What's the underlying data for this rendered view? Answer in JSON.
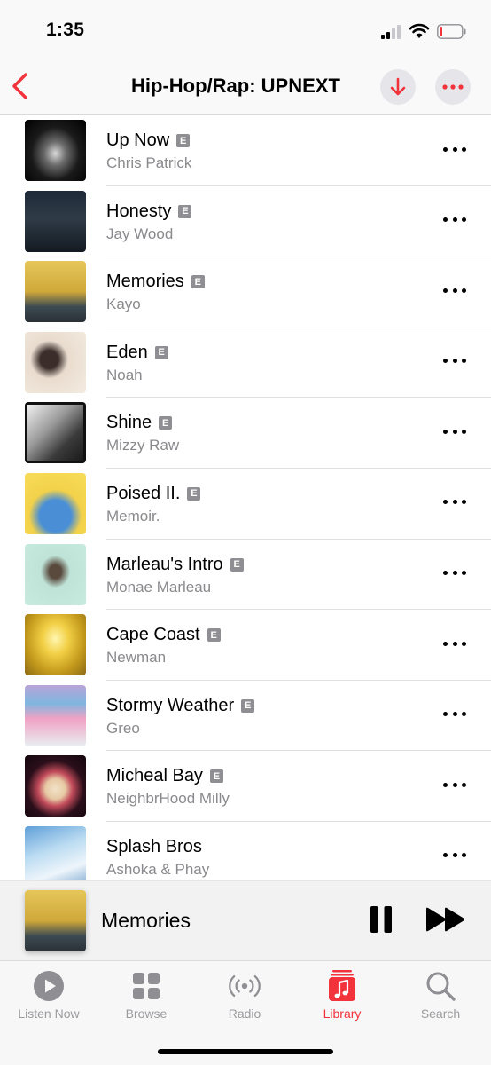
{
  "status": {
    "time": "1:35"
  },
  "nav": {
    "title": "Hip-Hop/Rap: UPNEXT"
  },
  "songs": [
    {
      "title": "Up Now",
      "artist": "Chris Patrick",
      "explicit": "E"
    },
    {
      "title": "Honesty",
      "artist": "Jay Wood",
      "explicit": "E"
    },
    {
      "title": "Memories",
      "artist": "Kayo",
      "explicit": "E"
    },
    {
      "title": "Eden",
      "artist": "Noah",
      "explicit": "E"
    },
    {
      "title": "Shine",
      "artist": "Mizzy Raw",
      "explicit": "E"
    },
    {
      "title": "Poised II.",
      "artist": "Memoir.",
      "explicit": "E"
    },
    {
      "title": "Marleau's Intro",
      "artist": "Monae Marleau",
      "explicit": "E"
    },
    {
      "title": "Cape Coast",
      "artist": "Newman",
      "explicit": "E"
    },
    {
      "title": "Stormy Weather",
      "artist": "Greo",
      "explicit": "E"
    },
    {
      "title": "Micheal Bay",
      "artist": "NeighbrHood Milly",
      "explicit": "E"
    },
    {
      "title": "Splash Bros",
      "artist": "Ashoka & Phay",
      "explicit": ""
    }
  ],
  "mini_player": {
    "title": "Memories"
  },
  "tabs": [
    {
      "label": "Listen Now",
      "icon": "play-circle-icon"
    },
    {
      "label": "Browse",
      "icon": "grid-icon"
    },
    {
      "label": "Radio",
      "icon": "radio-waves-icon"
    },
    {
      "label": "Library",
      "icon": "music-library-icon"
    },
    {
      "label": "Search",
      "icon": "search-icon"
    }
  ],
  "colors": {
    "accent": "#f2333b",
    "inactive": "#9b9b9f",
    "secondary_text": "#8a8a8e"
  }
}
